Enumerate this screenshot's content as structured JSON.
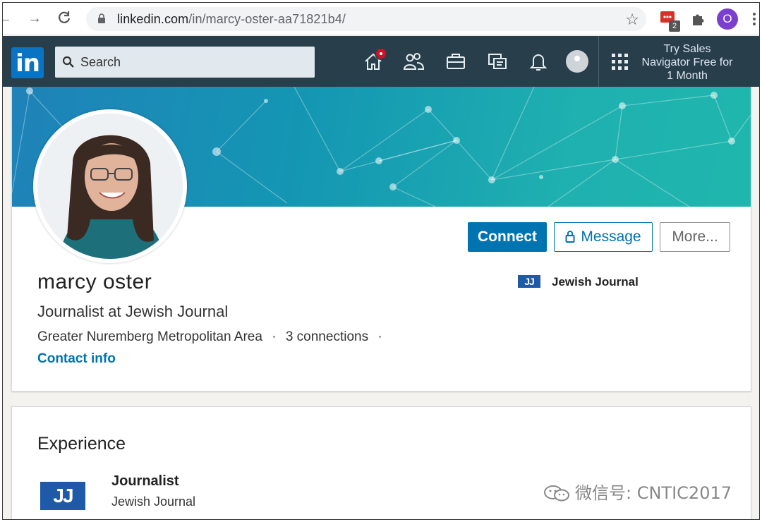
{
  "browser": {
    "url_host": "linkedin.com",
    "url_path": "/in/marcy-oster-aa71821b4/",
    "extension_badge": "2",
    "profile_initial": "O"
  },
  "linkedin_nav": {
    "logo_text": "in",
    "search_placeholder": "Search",
    "sales_navigator_line1": "Try Sales",
    "sales_navigator_line2": "Navigator Free for",
    "sales_navigator_line3": "1 Month"
  },
  "profile": {
    "name": "marcy oster",
    "headline": "Journalist at Jewish Journal",
    "location": "Greater Nuremberg Metropolitan Area",
    "separator": "·",
    "connections": "3 connections",
    "contact_info": "Contact info",
    "current_company": "Jewish Journal",
    "company_logo_text": "JJ"
  },
  "actions": {
    "connect": "Connect",
    "message": "Message",
    "more": "More..."
  },
  "experience": {
    "section_title": "Experience",
    "items": [
      {
        "role": "Journalist",
        "company": "Jewish Journal",
        "logo_text": "JJ"
      }
    ]
  },
  "watermark": "微信号: CNTIC2017",
  "colors": {
    "linkedin_blue": "#0073b1",
    "nav_bar": "#283e4a",
    "notification_red": "#d11124",
    "banner_teal": "#1497b3"
  }
}
